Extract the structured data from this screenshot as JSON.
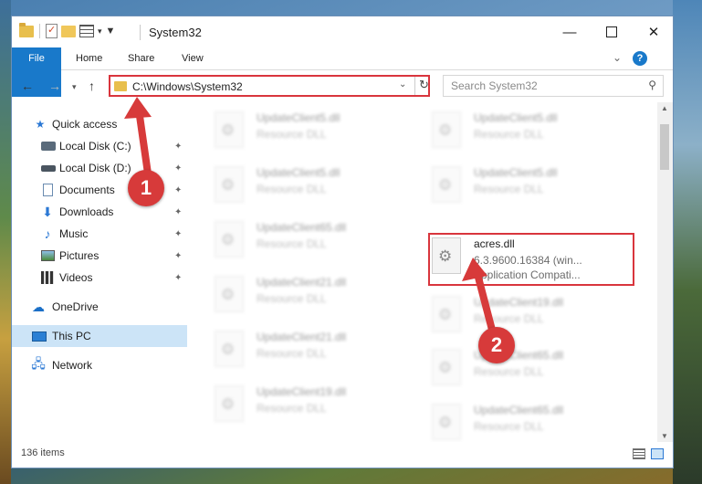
{
  "window": {
    "title": "System32",
    "minimize_glyph": "—",
    "close_glyph": "✕"
  },
  "ribbon": {
    "tabs": [
      "File",
      "Home",
      "Share",
      "View"
    ],
    "collapse_glyph": "⌄",
    "help_glyph": "?"
  },
  "nav": {
    "back_glyph": "←",
    "forward_glyph": "→",
    "recent_glyph": "▾",
    "up_glyph": "↑"
  },
  "address": {
    "path": "C:\\Windows\\System32",
    "dropdown_glyph": "⌄",
    "refresh_glyph": "↻"
  },
  "search": {
    "placeholder": "Search System32",
    "icon_glyph": "⚲"
  },
  "sidebar": {
    "items": [
      {
        "label": "Quick access",
        "icon": "star-icon",
        "pinned": false
      },
      {
        "label": "Local Disk (C:)",
        "icon": "disk-icon",
        "pinned": true
      },
      {
        "label": "Local Disk (D:)",
        "icon": "disk-icon",
        "pinned": true
      },
      {
        "label": "Documents",
        "icon": "document-icon",
        "pinned": true
      },
      {
        "label": "Downloads",
        "icon": "download-icon",
        "pinned": true
      },
      {
        "label": "Music",
        "icon": "music-icon",
        "pinned": true
      },
      {
        "label": "Pictures",
        "icon": "pictures-icon",
        "pinned": true
      },
      {
        "label": "Videos",
        "icon": "videos-icon",
        "pinned": true
      },
      {
        "label": "OneDrive",
        "icon": "cloud-icon",
        "pinned": false
      },
      {
        "label": "This PC",
        "icon": "pc-icon",
        "pinned": false,
        "selected": true
      },
      {
        "label": "Network",
        "icon": "network-icon",
        "pinned": false
      }
    ],
    "pin_glyph": "📌"
  },
  "files": {
    "left": [
      {
        "name": "UpdateClient5.dll",
        "meta": "Resource DLL"
      },
      {
        "name": "UpdateClient5.dll",
        "meta": "Resource DLL"
      },
      {
        "name": "UpdateClient65.dll",
        "meta": "Resource DLL"
      },
      {
        "name": "UpdateClient21.dll",
        "meta": "Resource DLL"
      },
      {
        "name": "UpdateClient21.dll",
        "meta": "Resource DLL"
      },
      {
        "name": "UpdateClient19.dll",
        "meta": "Resource DLL"
      }
    ],
    "right": [
      {
        "name": "UpdateClient5.dll",
        "meta": "Resource DLL"
      },
      {
        "name": "UpdateClient5.dll",
        "meta": "Resource DLL"
      },
      {
        "name": "UpdateClient19.dll",
        "meta": "Resource DLL"
      },
      {
        "name": "UpdateClient65.dll",
        "meta": "Resource DLL"
      },
      {
        "name": "UpdateClient65.dll",
        "meta": "Resource DLL"
      }
    ],
    "highlighted": {
      "name": "acres.dll",
      "version": "6.3.9600.16384 (win...",
      "description": "Application Compati..."
    }
  },
  "status": {
    "item_count": "136 items"
  },
  "callouts": [
    "1",
    "2"
  ],
  "colors": {
    "accent": "#1979ca",
    "callout_red": "#d73a3a",
    "selection": "#cce4f7"
  }
}
